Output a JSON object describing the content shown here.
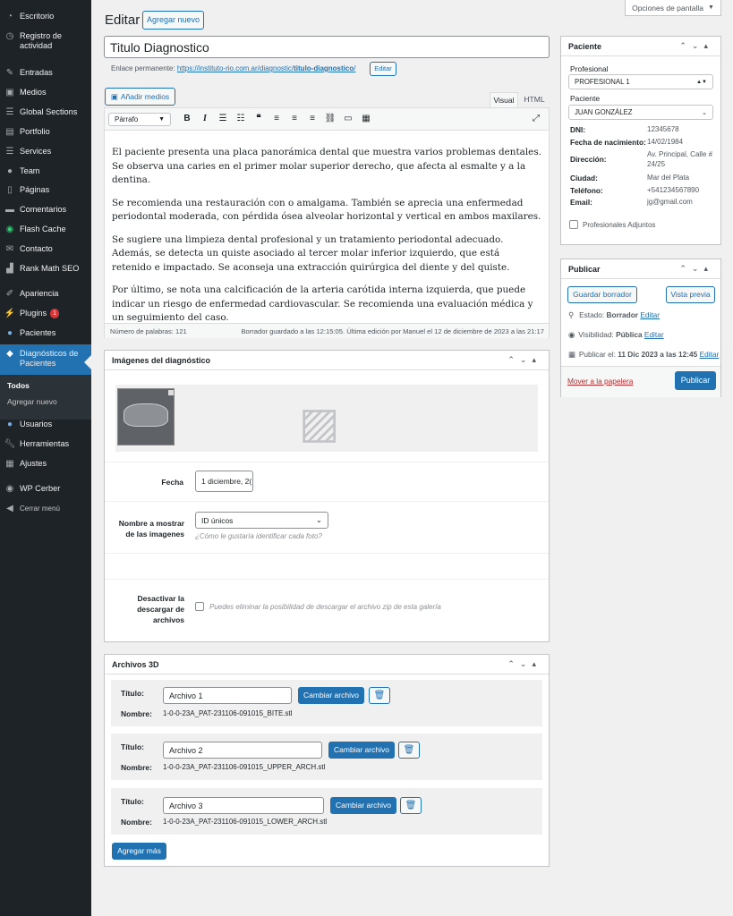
{
  "screen_options": "Opciones de pantalla",
  "sidebar": {
    "items": [
      {
        "label": "Escritorio",
        "icon": "dashboard-icon"
      },
      {
        "label": "Registro de actividad",
        "icon": "history-icon"
      },
      {
        "label": "Entradas",
        "icon": "pin-icon"
      },
      {
        "label": "Medios",
        "icon": "media-icon"
      },
      {
        "label": "Global Sections",
        "icon": "list-icon"
      },
      {
        "label": "Portfolio",
        "icon": "portfolio-icon"
      },
      {
        "label": "Services",
        "icon": "list-icon"
      },
      {
        "label": "Team",
        "icon": "user-icon"
      },
      {
        "label": "Páginas",
        "icon": "page-icon"
      },
      {
        "label": "Comentarios",
        "icon": "comment-icon"
      },
      {
        "label": "Flash Cache",
        "icon": "flash-icon"
      },
      {
        "label": "Contacto",
        "icon": "mail-icon"
      },
      {
        "label": "Rank Math SEO",
        "icon": "chart-icon"
      },
      {
        "label": "Apariencia",
        "icon": "brush-icon"
      },
      {
        "label": "Plugins",
        "icon": "plugin-icon",
        "badge": "1"
      },
      {
        "label": "Pacientes",
        "icon": "patients-icon"
      },
      {
        "label": "Diagnósticos de Pacientes",
        "icon": "diagnostics-icon"
      },
      {
        "label": "Usuarios",
        "icon": "users-icon"
      },
      {
        "label": "Herramientas",
        "icon": "wrench-icon"
      },
      {
        "label": "Ajustes",
        "icon": "settings-icon"
      },
      {
        "label": "WP Cerber",
        "icon": "shield-icon"
      },
      {
        "label": "Cerrar menú",
        "icon": "collapse-icon"
      }
    ],
    "submenu": {
      "todos": "Todos",
      "agregar": "Agregar nuevo"
    }
  },
  "header": {
    "title": "Editar",
    "add_new": "Agregar nuevo"
  },
  "post": {
    "title": "Titulo Diagnostico",
    "permalink_label": "Enlace permanente:",
    "permalink_base": "https://instituto-rio.com.ar/diagnostic/",
    "permalink_slug": "titulo-diagnostico",
    "permalink_end": "/",
    "edit_btn": "Editar"
  },
  "editor": {
    "add_media": "Añadir medios",
    "tab_visual": "Visual",
    "tab_html": "HTML",
    "format": "Párrafo",
    "paragraphs": [
      "El paciente presenta una placa panorámica dental que muestra varios problemas dentales. Se observa una caries en el primer molar superior derecho, que afecta al esmalte y a la dentina.",
      "Se recomienda una restauración con o amalgama. También se aprecia una enfermedad periodontal moderada, con pérdida ósea alveolar horizontal y vertical en ambos maxilares.",
      "Se sugiere una limpieza dental profesional y un tratamiento periodontal adecuado. Además, se detecta un quiste asociado al tercer molar inferior izquierdo, que está retenido e impactado. Se aconseja una extracción quirúrgica del diente y del quiste.",
      "Por último, se nota una calcificación de la arteria carótida interna izquierda, que puede indicar un riesgo de enfermedad  cardiovascular. Se recomienda una evaluación médica y un seguimiento del caso."
    ],
    "word_count": "Número de palabras: 121",
    "draft_status": "Borrador guardado a las 12:15:05. Última edición por Manuel el 12 de diciembre de 2023 a las 21:17"
  },
  "images_box": {
    "title": "Imágenes del diagnóstico",
    "fecha_label": "Fecha",
    "fecha_value": "1 diciembre, 2(",
    "nombre_label": "Nombre a mostrar de las imagenes",
    "nombre_value": "ID únicos",
    "nombre_hint": "¿Cómo le gustaría identificar cada foto?",
    "desactivar_label": "Desactivar la descargar de archivos",
    "desactivar_hint": "Puedes eliminar la posibilidad de descargar el archivo zip de esta galería"
  },
  "files_box": {
    "title": "Archivos 3D",
    "titulo_label": "Título:",
    "nombre_label": "Nombre:",
    "change_btn": "Cambiar archivo",
    "add_more": "Agregar más",
    "files": [
      {
        "title": "Archivo 1",
        "name": "1-0-0-23A_PAT-231106-091015_BITE.stl"
      },
      {
        "title": "Archivo 2",
        "name": "1-0-0-23A_PAT-231106-091015_UPPER_ARCH.stl"
      },
      {
        "title": "Archivo 3",
        "name": "1-0-0-23A_PAT-231106-091015_LOWER_ARCH.stl"
      }
    ]
  },
  "paciente_box": {
    "title": "Paciente",
    "profesional_label": "Profesional",
    "profesional_value": "PROFESIONAL 1",
    "paciente_label": "Paciente",
    "paciente_value": "JUAN GONZÁLEZ",
    "fields": [
      {
        "label": "DNI:",
        "value": "12345678"
      },
      {
        "label": "Fecha de nacimiento:",
        "value": "14/02/1984"
      },
      {
        "label": "Dirección:",
        "value": "Av. Principal, Calle # 24/25"
      },
      {
        "label": "Ciudad:",
        "value": "Mar del Plata"
      },
      {
        "label": "Teléfono:",
        "value": "+541234567890"
      },
      {
        "label": "Email:",
        "value": "jg@gmail.com"
      }
    ],
    "adjuntos": "Profesionales Adjuntos"
  },
  "publish_box": {
    "title": "Publicar",
    "save_draft": "Guardar borrador",
    "preview": "Vista previa",
    "estado_label": "Estado:",
    "estado_value": "Borrador",
    "visibilidad_label": "Visibilidad:",
    "visibilidad_value": "Pública",
    "publicar_label": "Publicar el:",
    "publicar_value": "11 Dic 2023 a las 12:45",
    "edit": "Editar",
    "trash": "Mover a la papelera",
    "publish": "Publicar"
  },
  "colors": {
    "accent": "#2271b1",
    "sidebar": "#1d2327",
    "trash": "#b32d2e",
    "badge": "#d63638"
  }
}
